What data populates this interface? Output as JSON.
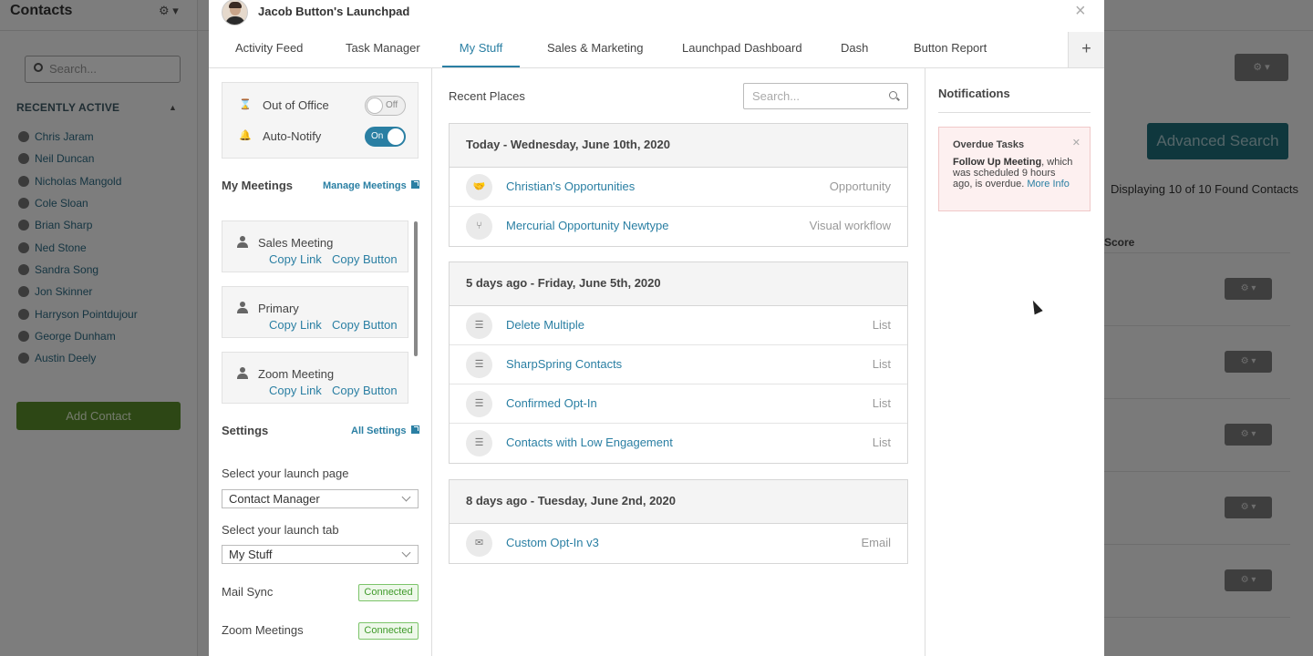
{
  "background": {
    "sidebar_title": "Contacts",
    "search_placeholder": "Search...",
    "recently_active_label": "RECENTLY ACTIVE",
    "contacts": [
      "Chris Jaram",
      "Neil Duncan",
      "Nicholas Mangold",
      "Cole Sloan",
      "Brian Sharp",
      "Ned Stone",
      "Sandra Song",
      "Jon Skinner",
      "Harryson Pointdujour",
      "George Dunham",
      "Austin Deely"
    ],
    "add_contact_label": "Add Contact",
    "advanced_search_label": "Advanced Search",
    "displaying_text": "Displaying 10 of 10 Found Contacts",
    "score_header": "Score"
  },
  "modal": {
    "title": "Jacob Button's Launchpad",
    "close_icon": "×",
    "tabs": [
      {
        "label": "Activity Feed"
      },
      {
        "label": "Task Manager"
      },
      {
        "label": "My Stuff",
        "active": true
      },
      {
        "label": "Sales & Marketing"
      },
      {
        "label": "Launchpad Dashboard"
      },
      {
        "label": "Dash"
      },
      {
        "label": "Button Report"
      }
    ],
    "add_tab_icon": "+"
  },
  "left": {
    "out_of_office": {
      "label": "Out of Office",
      "toggle": "Off"
    },
    "auto_notify": {
      "label": "Auto-Notify",
      "toggle": "On"
    },
    "meetings_title": "My Meetings",
    "manage_meetings_label": "Manage Meetings",
    "meetings": [
      {
        "name": "Sales Meeting",
        "copy_link": "Copy Link",
        "copy_button": "Copy Button"
      },
      {
        "name": "Primary",
        "copy_link": "Copy Link",
        "copy_button": "Copy Button"
      },
      {
        "name": "Zoom Meeting",
        "copy_link": "Copy Link",
        "copy_button": "Copy Button"
      }
    ],
    "settings_title": "Settings",
    "all_settings_label": "All Settings",
    "launch_page_label": "Select your launch page",
    "launch_page_value": "Contact Manager",
    "launch_tab_label": "Select your launch tab",
    "launch_tab_value": "My Stuff",
    "mail_sync_label": "Mail Sync",
    "mail_sync_status": "Connected",
    "zoom_meetings_label": "Zoom Meetings",
    "zoom_meetings_status": "Connected"
  },
  "middle": {
    "title": "Recent Places",
    "search_placeholder": "Search...",
    "groups": [
      {
        "heading": "Today - Wednesday, June 10th, 2020",
        "items": [
          {
            "name": "Christian's Opportunities",
            "type": "Opportunity",
            "icon": "handshake-icon"
          },
          {
            "name": "Mercurial Opportunity Newtype",
            "type": "Visual workflow",
            "icon": "workflow-icon"
          }
        ]
      },
      {
        "heading": "5 days ago - Friday, June 5th, 2020",
        "items": [
          {
            "name": "Delete Multiple",
            "type": "List",
            "icon": "list-icon"
          },
          {
            "name": "SharpSpring Contacts",
            "type": "List",
            "icon": "list-icon"
          },
          {
            "name": "Confirmed Opt-In",
            "type": "List",
            "icon": "list-icon"
          },
          {
            "name": "Contacts with Low Engagement",
            "type": "List",
            "icon": "list-icon"
          }
        ]
      },
      {
        "heading": "8 days ago - Tuesday, June 2nd, 2020",
        "items": [
          {
            "name": "Custom Opt-In v3",
            "type": "Email",
            "icon": "envelope-icon"
          }
        ]
      }
    ]
  },
  "right": {
    "title": "Notifications",
    "card": {
      "heading": "Overdue Tasks",
      "bold_text": "Follow Up Meeting",
      "text": ", which was scheduled 9 hours ago, is overdue.",
      "more_label": "More Info"
    }
  }
}
